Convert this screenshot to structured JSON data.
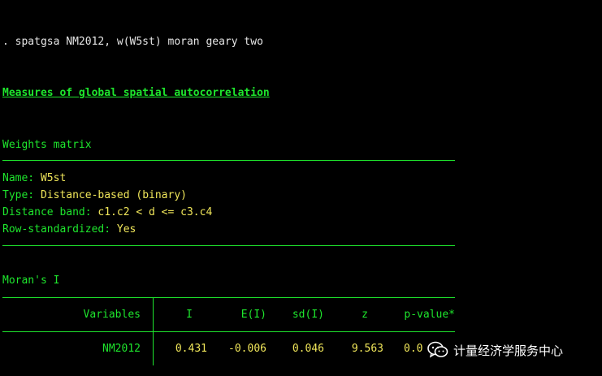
{
  "command": ". spatgsa NM2012, w(W5st) moran geary two",
  "heading": "Measures of global spatial autocorrelation",
  "weights": {
    "title": "Weights matrix",
    "name_label": "Name:",
    "name_value": "W5st",
    "type_label": "Type:",
    "type_value": "Distance-based (binary)",
    "band_label": "Distance band:",
    "band_value": "c1.c2 < d <= c3.c4",
    "rowstd_label": "Row-standardized:",
    "rowstd_value": "Yes"
  },
  "moran": {
    "title": "Moran's I",
    "headers": [
      "Variables",
      "I",
      "E(I)",
      "sd(I)",
      "z",
      "p-value*"
    ],
    "rows": [
      {
        "variable": "NM2012",
        "I": "0.431",
        "EI": "-0.006",
        "sdI": "0.046",
        "z": "9.563",
        "p": "0.0"
      }
    ]
  },
  "watermark": {
    "icon": "wechat-icon",
    "text": "计量经济学服务中心"
  },
  "colors": {
    "background": "#000000",
    "green": "#1ee62d",
    "yellow": "#f0e65a",
    "white": "#e6e6e6"
  }
}
